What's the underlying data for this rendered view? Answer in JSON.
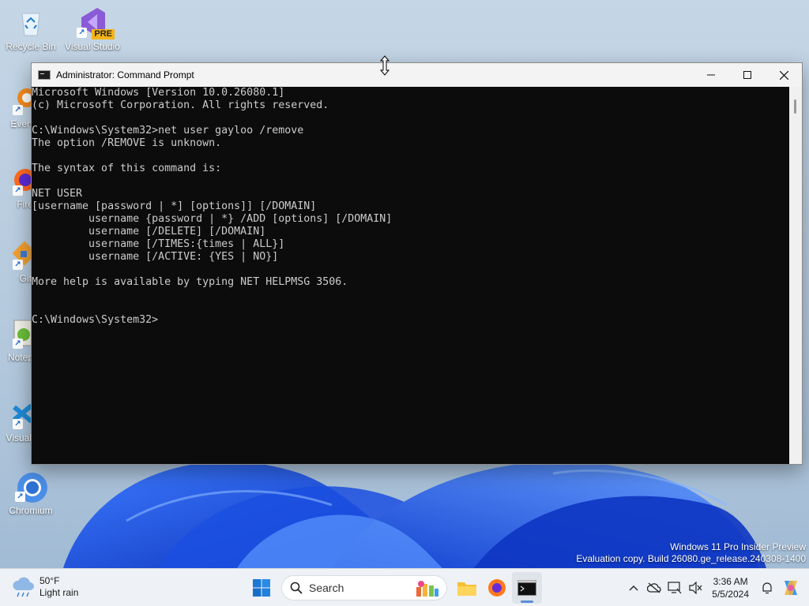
{
  "desktop": {
    "icons": [
      {
        "label": "Recycle Bin"
      },
      {
        "label": "Visual Studio",
        "badge": "PRE"
      },
      {
        "label": "Every"
      },
      {
        "label": "Fire"
      },
      {
        "label": "Git"
      },
      {
        "label": "Notep"
      },
      {
        "label": "Visual"
      },
      {
        "label": "Chromium"
      }
    ]
  },
  "window": {
    "title": "Administrator: Command Prompt",
    "minimize_icon": "minimize-icon",
    "maximize_icon": "maximize-icon",
    "close_icon": "close-icon"
  },
  "terminal": {
    "lines": [
      "Microsoft Windows [Version 10.0.26080.1]",
      "(c) Microsoft Corporation. All rights reserved.",
      "",
      "C:\\Windows\\System32>net user gayloo /remove",
      "The option /REMOVE is unknown.",
      "",
      "The syntax of this command is:",
      "",
      "NET USER",
      "[username [password | *] [options]] [/DOMAIN]",
      "         username {password | *} /ADD [options] [/DOMAIN]",
      "         username [/DELETE] [/DOMAIN]",
      "         username [/TIMES:{times | ALL}]",
      "         username [/ACTIVE: {YES | NO}]",
      "",
      "More help is available by typing NET HELPMSG 3506.",
      "",
      "",
      "C:\\Windows\\System32>"
    ]
  },
  "watermark": {
    "line1": "Windows 11 Pro Insider Preview",
    "line2": "Evaluation copy. Build 26080.ge_release.240308-1400"
  },
  "taskbar": {
    "weather_temp": "50°F",
    "weather_desc": "Light rain",
    "search_placeholder": "Search",
    "time": "3:36 AM",
    "date": "5/5/2024"
  },
  "colors": {
    "terminal_bg": "#0c0c0c",
    "terminal_fg": "#cccccc",
    "accent": "#0067c0"
  }
}
